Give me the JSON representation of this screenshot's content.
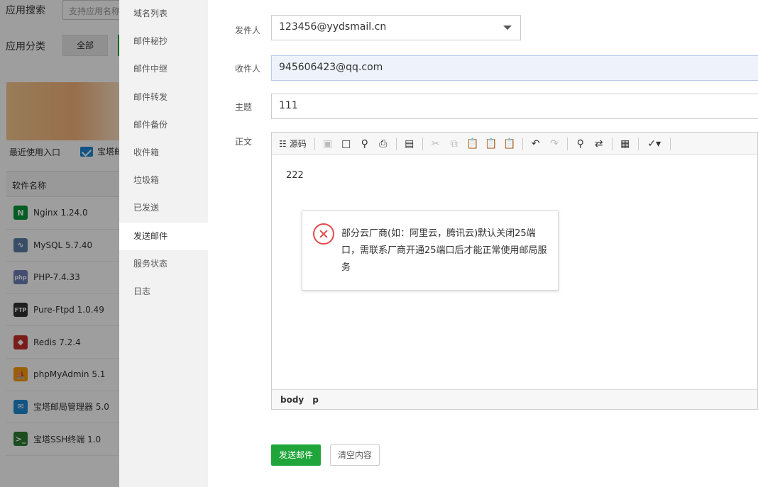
{
  "background": {
    "search_label": "应用搜索",
    "search_placeholder": "支持应用名称",
    "category_label": "应用分类",
    "category_all": "全部",
    "recent_label": "最近使用入口",
    "recent_item": "宝塔邮",
    "table_header": "软件名称",
    "software": [
      {
        "name": "Nginx 1.24.0",
        "icon": "nginx-icon",
        "color": "#009639",
        "glyph": "N"
      },
      {
        "name": "MySQL 5.7.40",
        "icon": "mysql-icon",
        "color": "#5b7fa6",
        "glyph": "∿"
      },
      {
        "name": "PHP-7.4.33",
        "icon": "php-icon",
        "color": "#6c7eb7",
        "glyph": "php"
      },
      {
        "name": "Pure-Ftpd 1.0.49",
        "icon": "ftp-icon",
        "color": "#333333",
        "glyph": "FTP"
      },
      {
        "name": "Redis 7.2.4",
        "icon": "redis-icon",
        "color": "#c6302b",
        "glyph": "◆"
      },
      {
        "name": "phpMyAdmin 5.1",
        "icon": "phpmyadmin-icon",
        "color": "#f89c0e",
        "glyph": "⛵"
      },
      {
        "name": "宝塔邮局管理器 5.0",
        "icon": "mail-manager-icon",
        "color": "#1e88d6",
        "glyph": "✉"
      },
      {
        "name": "宝塔SSH终端 1.0",
        "icon": "ssh-terminal-icon",
        "color": "#2e7d32",
        "glyph": ">_"
      }
    ]
  },
  "menu": {
    "items": [
      {
        "label": "域名列表",
        "active": false
      },
      {
        "label": "邮件秘抄",
        "active": false
      },
      {
        "label": "邮件中继",
        "active": false
      },
      {
        "label": "邮件转发",
        "active": false
      },
      {
        "label": "邮件备份",
        "active": false
      },
      {
        "label": "收件箱",
        "active": false
      },
      {
        "label": "垃圾箱",
        "active": false
      },
      {
        "label": "已发送",
        "active": false
      },
      {
        "label": "发送邮件",
        "active": true
      },
      {
        "label": "服务状态",
        "active": false
      },
      {
        "label": "日志",
        "active": false
      }
    ]
  },
  "form": {
    "sender_label": "发件人",
    "sender_value": "123456@yydsmail.cn",
    "recipient_label": "收件人",
    "recipient_value": "945606423@qq.com",
    "subject_label": "主题",
    "subject_value": "111",
    "body_label": "正文",
    "body_text": "222",
    "source_label": "源码",
    "path_items": [
      "body",
      "p"
    ],
    "send_button": "发送邮件",
    "clear_button": "清空内容"
  },
  "toast": {
    "message": "部分云厂商(如：阿里云，腾讯云)默认关闭25端口，需联系厂商开通25端口后才能正常使用邮局服务",
    "icon": "error-icon",
    "color": "#e34a4a"
  },
  "colors": {
    "accent": "#20a53a",
    "error": "#e34a4a"
  }
}
